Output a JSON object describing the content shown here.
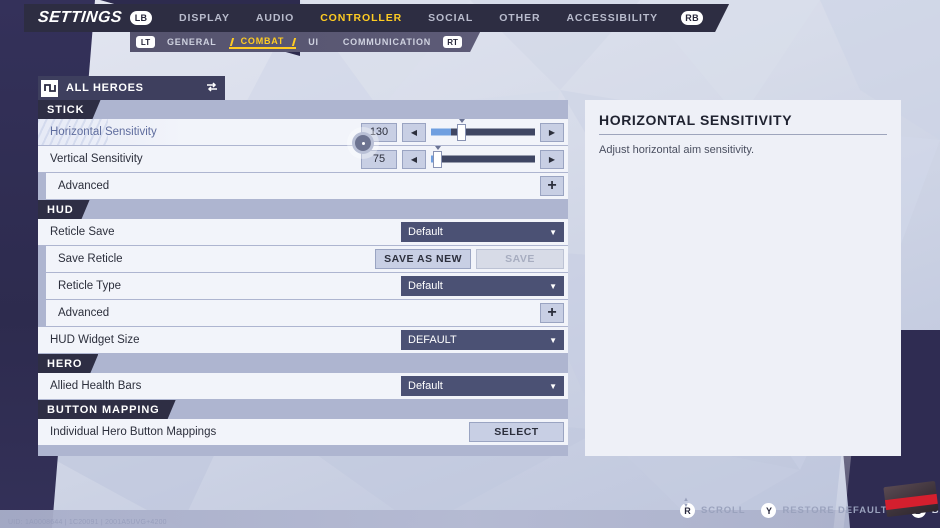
{
  "header": {
    "title": "SETTINGS",
    "bumper_left": "LB",
    "bumper_right": "RB",
    "tabs": [
      {
        "label": "DISPLAY",
        "active": false
      },
      {
        "label": "AUDIO",
        "active": false
      },
      {
        "label": "CONTROLLER",
        "active": true
      },
      {
        "label": "SOCIAL",
        "active": false
      },
      {
        "label": "OTHER",
        "active": false
      },
      {
        "label": "ACCESSIBILITY",
        "active": false
      }
    ]
  },
  "subnav": {
    "trigger_left": "LT",
    "trigger_right": "RT",
    "tabs": [
      {
        "label": "GENERAL",
        "active": false
      },
      {
        "label": "COMBAT",
        "active": true
      },
      {
        "label": "UI",
        "active": false
      },
      {
        "label": "COMMUNICATION",
        "active": false
      }
    ]
  },
  "hero_selector": {
    "icon": "hero-roster-icon",
    "label": "ALL HEROES",
    "swap_icon": "swap-vertical-icon"
  },
  "sections": [
    {
      "title": "STICK",
      "rows": [
        {
          "label": "Horizontal Sensitivity",
          "type": "slider",
          "selected": true,
          "indent": false,
          "value": "130",
          "percent": 26,
          "fill_percent": 19,
          "left_arrow": "◀",
          "right_arrow": "▶"
        },
        {
          "label": "Vertical Sensitivity",
          "type": "slider",
          "selected": false,
          "indent": false,
          "value": "75",
          "percent": 3,
          "fill_percent": 2,
          "left_arrow": "◀",
          "right_arrow": "▶"
        },
        {
          "label": "Advanced",
          "type": "expand",
          "selected": false,
          "indent": true,
          "plus": "+"
        }
      ]
    },
    {
      "title": "HUD",
      "rows": [
        {
          "label": "Reticle Save",
          "type": "dropdown",
          "selected": false,
          "indent": false,
          "value": "Default",
          "caret": "▼"
        },
        {
          "label": "Save Reticle",
          "type": "buttons",
          "selected": false,
          "indent": true,
          "buttons": [
            {
              "label": "SAVE AS NEW",
              "disabled": false
            },
            {
              "label": "SAVE",
              "disabled": true
            }
          ]
        },
        {
          "label": "Reticle Type",
          "type": "dropdown",
          "selected": false,
          "indent": true,
          "value": "Default",
          "caret": "▼"
        },
        {
          "label": "Advanced",
          "type": "expand",
          "selected": false,
          "indent": true,
          "plus": "+"
        },
        {
          "label": "HUD Widget Size",
          "type": "dropdown",
          "selected": false,
          "indent": false,
          "value": "DEFAULT",
          "caret": "▼"
        }
      ]
    },
    {
      "title": "HERO",
      "rows": [
        {
          "label": "Allied Health Bars",
          "type": "dropdown",
          "selected": false,
          "indent": false,
          "value": "Default",
          "caret": "▼"
        }
      ]
    },
    {
      "title": "BUTTON MAPPING",
      "rows": [
        {
          "label": "Individual Hero Button Mappings",
          "type": "buttons",
          "selected": false,
          "indent": false,
          "buttons": [
            {
              "label": "SELECT",
              "disabled": false
            }
          ]
        }
      ]
    }
  ],
  "info_panel": {
    "title": "HORIZONTAL SENSITIVITY",
    "description": "Adjust horizontal aim sensitivity."
  },
  "prompts": [
    {
      "glyph": "R",
      "label": "SCROLL",
      "on_dark": false
    },
    {
      "glyph": "Y",
      "label": "RESTORE DEFAULTS",
      "on_dark": false
    },
    {
      "glyph": "B",
      "label": "BACK",
      "on_dark": true
    }
  ],
  "footer": {
    "uid": "UID: 1A0008644 | 1C20091 | 2001A5UVG+4200"
  },
  "colors": {
    "accent": "#ffcc22",
    "panel": "#f2f4fa",
    "panel_bg": "#aeb5d0",
    "dropdown": "#4b5174",
    "dark": "#2e2e44",
    "slider_fill": "#6f9fe0",
    "info_panel": "#eef0f7"
  }
}
